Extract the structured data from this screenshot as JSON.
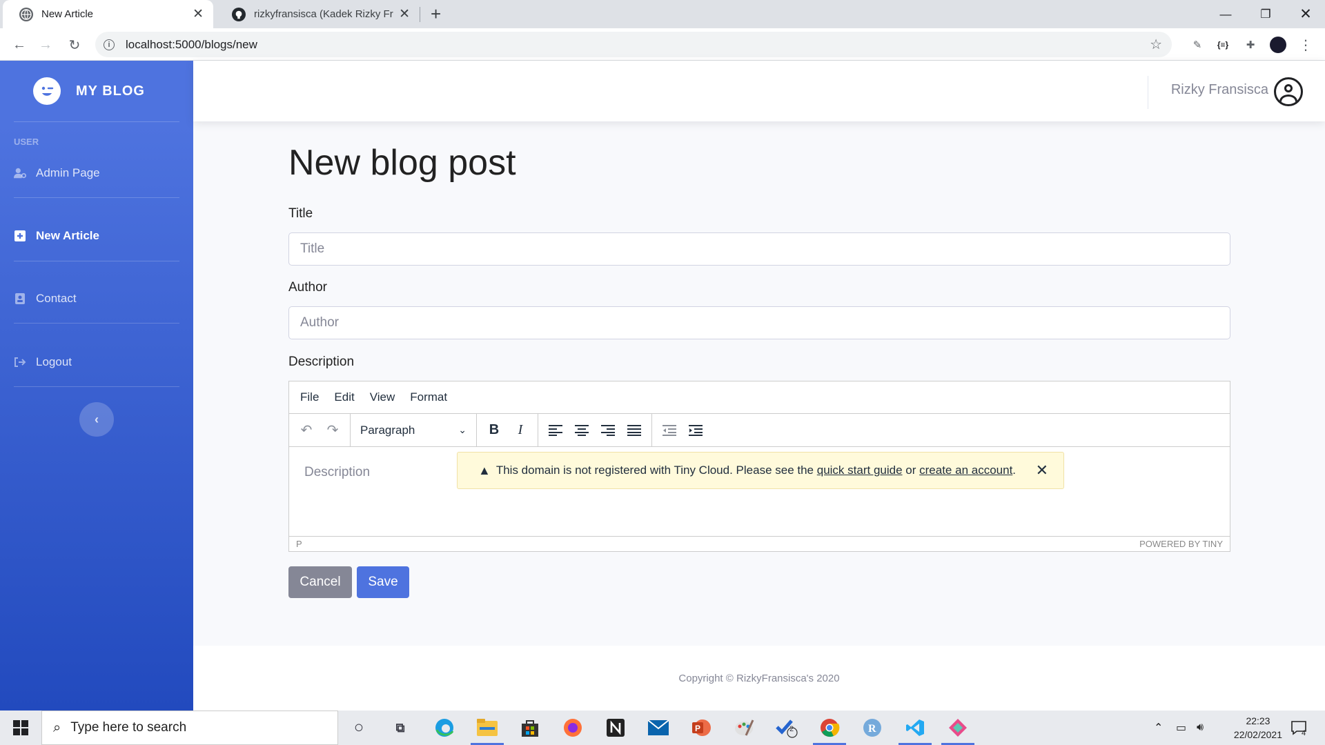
{
  "browser": {
    "tabs": [
      {
        "title": "New Article",
        "active": true
      },
      {
        "title": "rizkyfransisca (Kadek Rizky Fransisca)",
        "active": false
      }
    ],
    "new_tab": "+",
    "url": "localhost:5000/blogs/new"
  },
  "sidebar": {
    "brand": "MY BLOG",
    "heading": "USER",
    "items": [
      {
        "label": "Admin Page",
        "icon": "user-cog-icon",
        "active": false
      },
      {
        "label": "New Article",
        "icon": "plus-square-icon",
        "active": true
      },
      {
        "label": "Contact",
        "icon": "address-book-icon",
        "active": false
      },
      {
        "label": "Logout",
        "icon": "sign-out-icon",
        "active": false
      }
    ],
    "toggle": "‹"
  },
  "topbar": {
    "user_name": "Rizky Fransisca"
  },
  "form": {
    "page_title": "New blog post",
    "title_label": "Title",
    "title_placeholder": "Title",
    "author_label": "Author",
    "author_placeholder": "Author",
    "description_label": "Description",
    "editor": {
      "menu": [
        "File",
        "Edit",
        "View",
        "Format"
      ],
      "block_format": "Paragraph",
      "placeholder": "Description",
      "notice": {
        "text_before": "This domain is not registered with Tiny Cloud. Please see the",
        "link1": "quick start guide",
        "middle": "or",
        "link2": "create an account",
        "after": "."
      },
      "status_path": "P",
      "powered_by": "POWERED BY TINY"
    },
    "cancel_label": "Cancel",
    "save_label": "Save"
  },
  "footer": {
    "copyright": "Copyright © RizkyFransisca's 2020"
  },
  "taskbar": {
    "search_placeholder": "Type here to search",
    "time": "22:23",
    "date": "22/02/2021",
    "notification_count": "4",
    "todo_badge": "2"
  },
  "colors": {
    "primary": "#4e73df",
    "sidebar_gradient_end": "#224abe",
    "secondary": "#858796"
  }
}
